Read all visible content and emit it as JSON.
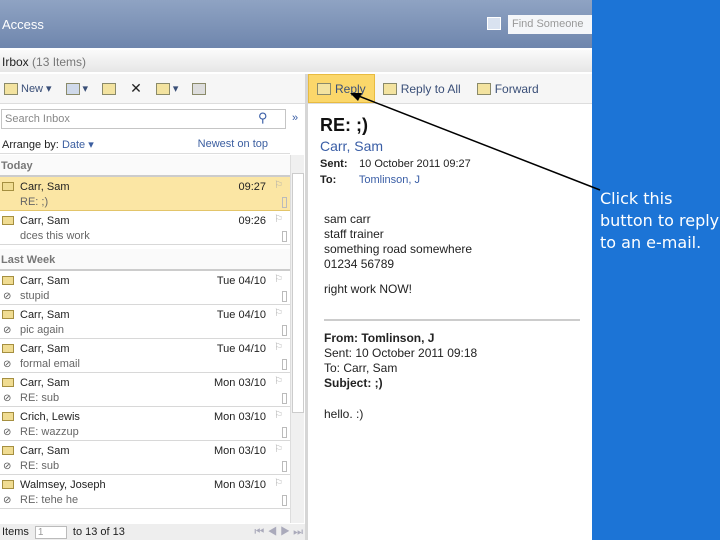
{
  "title": "Access",
  "find_placeholder": "Find Someone",
  "inbox": {
    "name": "Irbox",
    "count": "(13 Items)"
  },
  "toolbar": {
    "new": "New",
    "delete": "✕"
  },
  "search_placeholder": "Search Inbox",
  "arrange": {
    "label": "Arrange by:",
    "value": "Date",
    "sort": "Newest on top"
  },
  "groups": {
    "today": "Today",
    "last_week": "Last Week"
  },
  "today": [
    {
      "from": "Carr, Sam",
      "subject": "RE: ;)",
      "date": "09:27"
    },
    {
      "from": "Carr, Sam",
      "subject": "dces this work",
      "date": "09:26"
    }
  ],
  "last_week": [
    {
      "from": "Carr, Sam",
      "subject": "stupid",
      "date": "Tue 04/10"
    },
    {
      "from": "Carr, Sam",
      "subject": "pic again",
      "date": "Tue 04/10"
    },
    {
      "from": "Carr, Sam",
      "subject": "formal email",
      "date": "Tue 04/10"
    },
    {
      "from": "Carr, Sam",
      "subject": "RE: sub",
      "date": "Mon 03/10"
    },
    {
      "from": "Crich, Lewis",
      "subject": "RE: wazzup",
      "date": "Mon 03/10"
    },
    {
      "from": "Carr, Sam",
      "subject": "RE: sub",
      "date": "Mon 03/10"
    },
    {
      "from": "Walmsey, Joseph",
      "subject": "RE: tehe he",
      "date": "Mon 03/10"
    }
  ],
  "footer": {
    "items": "Items",
    "page": "1",
    "range": "to 13 of 13"
  },
  "reading_toolbar": {
    "reply": "Reply",
    "reply_all": "Reply to All",
    "forward": "Forward"
  },
  "message": {
    "subject": "RE: ;)",
    "from": "Carr, Sam",
    "sent_label": "Sent:",
    "sent": "10 October 2011 09:27",
    "to_label": "To:",
    "to": "Tomlinson, J",
    "body": [
      "sam carr",
      "staff trainer",
      "something road somewhere",
      "01234 56789"
    ],
    "body2": "right work NOW!",
    "quoted": {
      "from": "From: Tomlinson, J",
      "sent": "Sent: 10 October 2011 09:18",
      "to": "To: Carr, Sam",
      "subject": "Subject: ;)",
      "body": "hello. :)"
    }
  },
  "callout": "Click this button to reply to an e-mail."
}
